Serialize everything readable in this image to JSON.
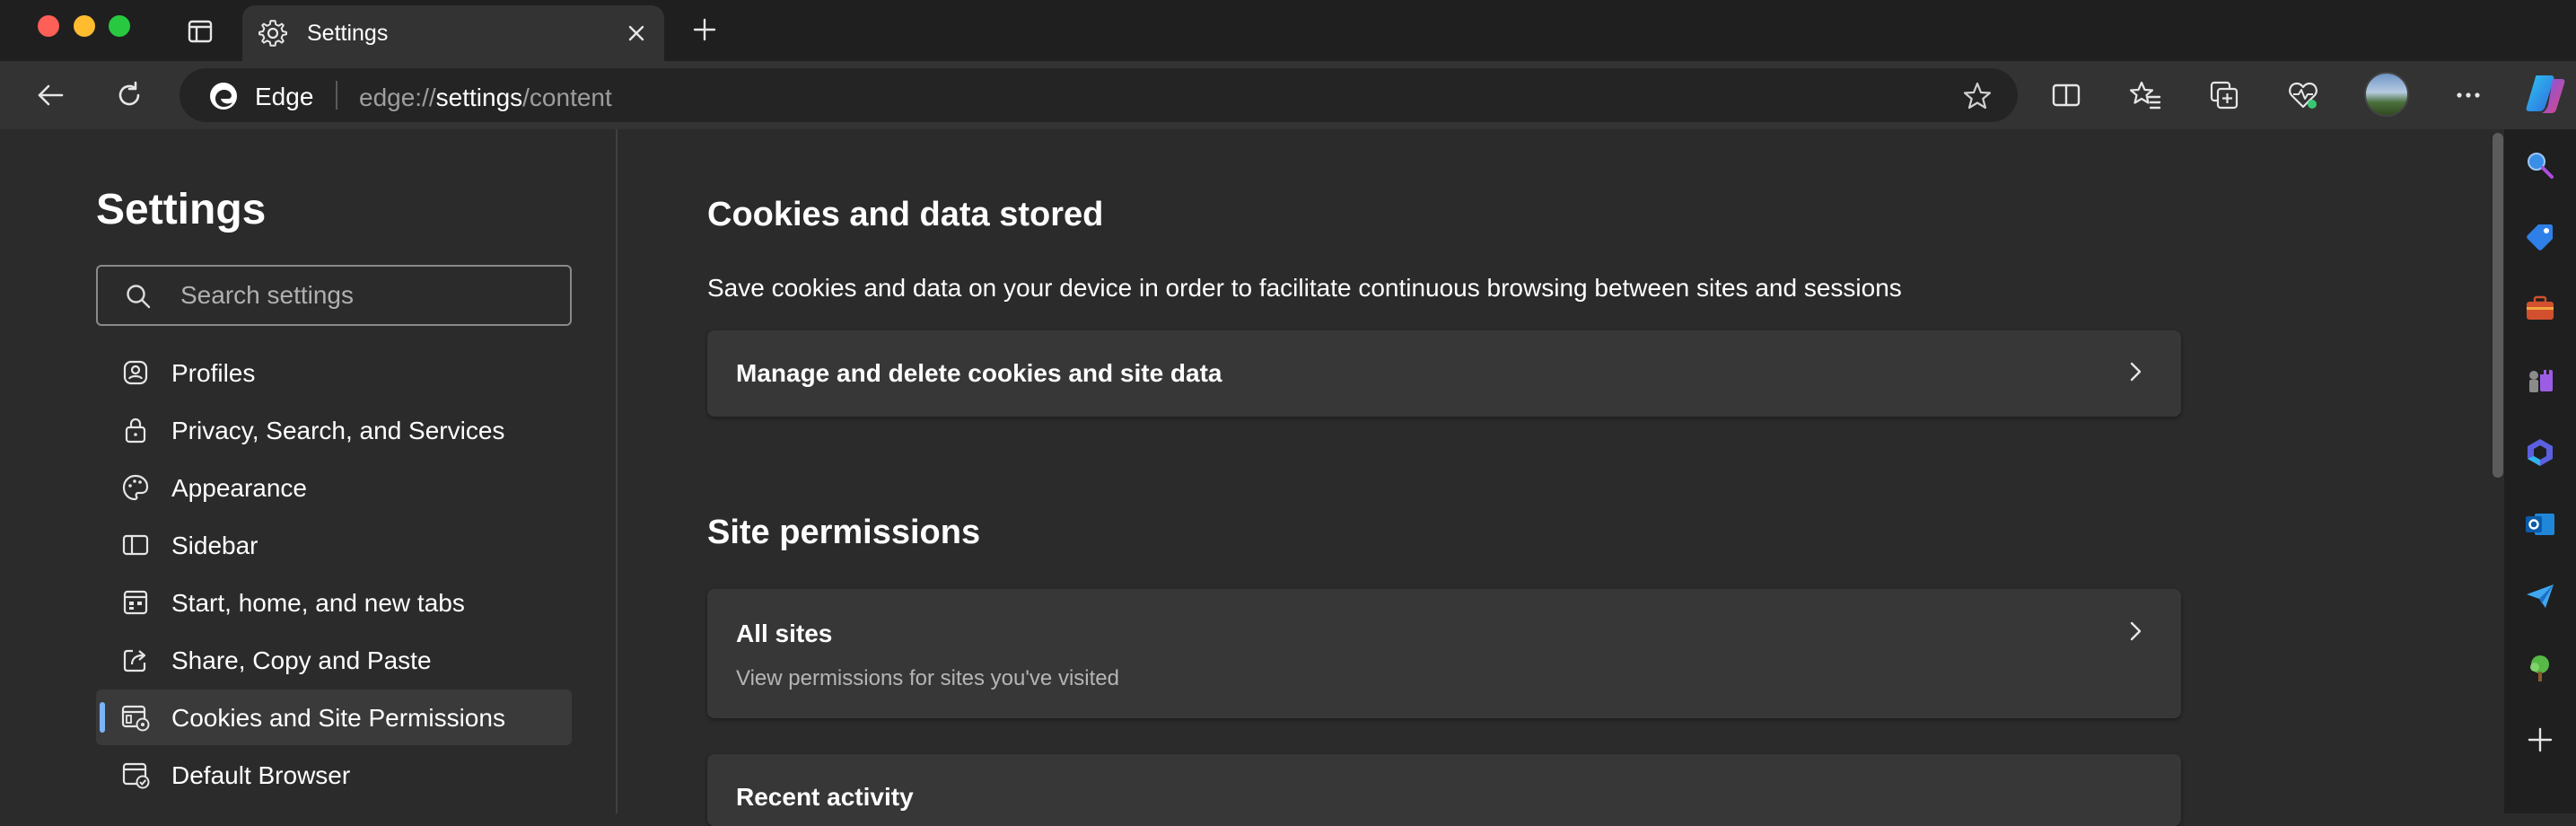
{
  "window": {
    "controls": [
      "close",
      "minimize",
      "zoom"
    ]
  },
  "tabs": [
    {
      "title": "Settings",
      "icon": "gear-icon",
      "active": true
    }
  ],
  "toolbar": {
    "browser_name": "Edge",
    "url_scheme": "edge://",
    "url_host": "settings",
    "url_path": "/content"
  },
  "sidebar_nav": {
    "title": "Settings",
    "search_placeholder": "Search settings",
    "items": [
      {
        "label": "Profiles",
        "icon": "profile-icon",
        "active": false
      },
      {
        "label": "Privacy, Search, and Services",
        "icon": "lock-icon",
        "active": false
      },
      {
        "label": "Appearance",
        "icon": "palette-icon",
        "active": false
      },
      {
        "label": "Sidebar",
        "icon": "sidebar-icon",
        "active": false
      },
      {
        "label": "Start, home, and new tabs",
        "icon": "home-tabs-icon",
        "active": false
      },
      {
        "label": "Share, Copy and Paste",
        "icon": "share-icon",
        "active": false
      },
      {
        "label": "Cookies and Site Permissions",
        "icon": "cookies-permissions-icon",
        "active": true
      },
      {
        "label": "Default Browser",
        "icon": "default-browser-icon",
        "active": false
      }
    ]
  },
  "main": {
    "cookies_section": {
      "title": "Cookies and data stored",
      "description": "Save cookies and data on your device in order to facilitate continuous browsing between sites and sessions",
      "card_title": "Manage and delete cookies and site data"
    },
    "permissions_section": {
      "title": "Site permissions",
      "all_sites_title": "All sites",
      "all_sites_subtitle": "View permissions for sites you've visited",
      "recent_activity_title": "Recent activity"
    }
  },
  "right_sidebar": {
    "items": [
      "search-icon",
      "shopping-tag-icon",
      "tools-briefcase-icon",
      "games-chess-icon",
      "microsoft-365-icon",
      "outlook-icon",
      "send-icon",
      "tree-icon",
      "add-icon"
    ]
  },
  "colors": {
    "accent": "#7ab4f5",
    "background": "#2b2b2b",
    "card": "#373737",
    "frame": "#1f1f1f"
  }
}
